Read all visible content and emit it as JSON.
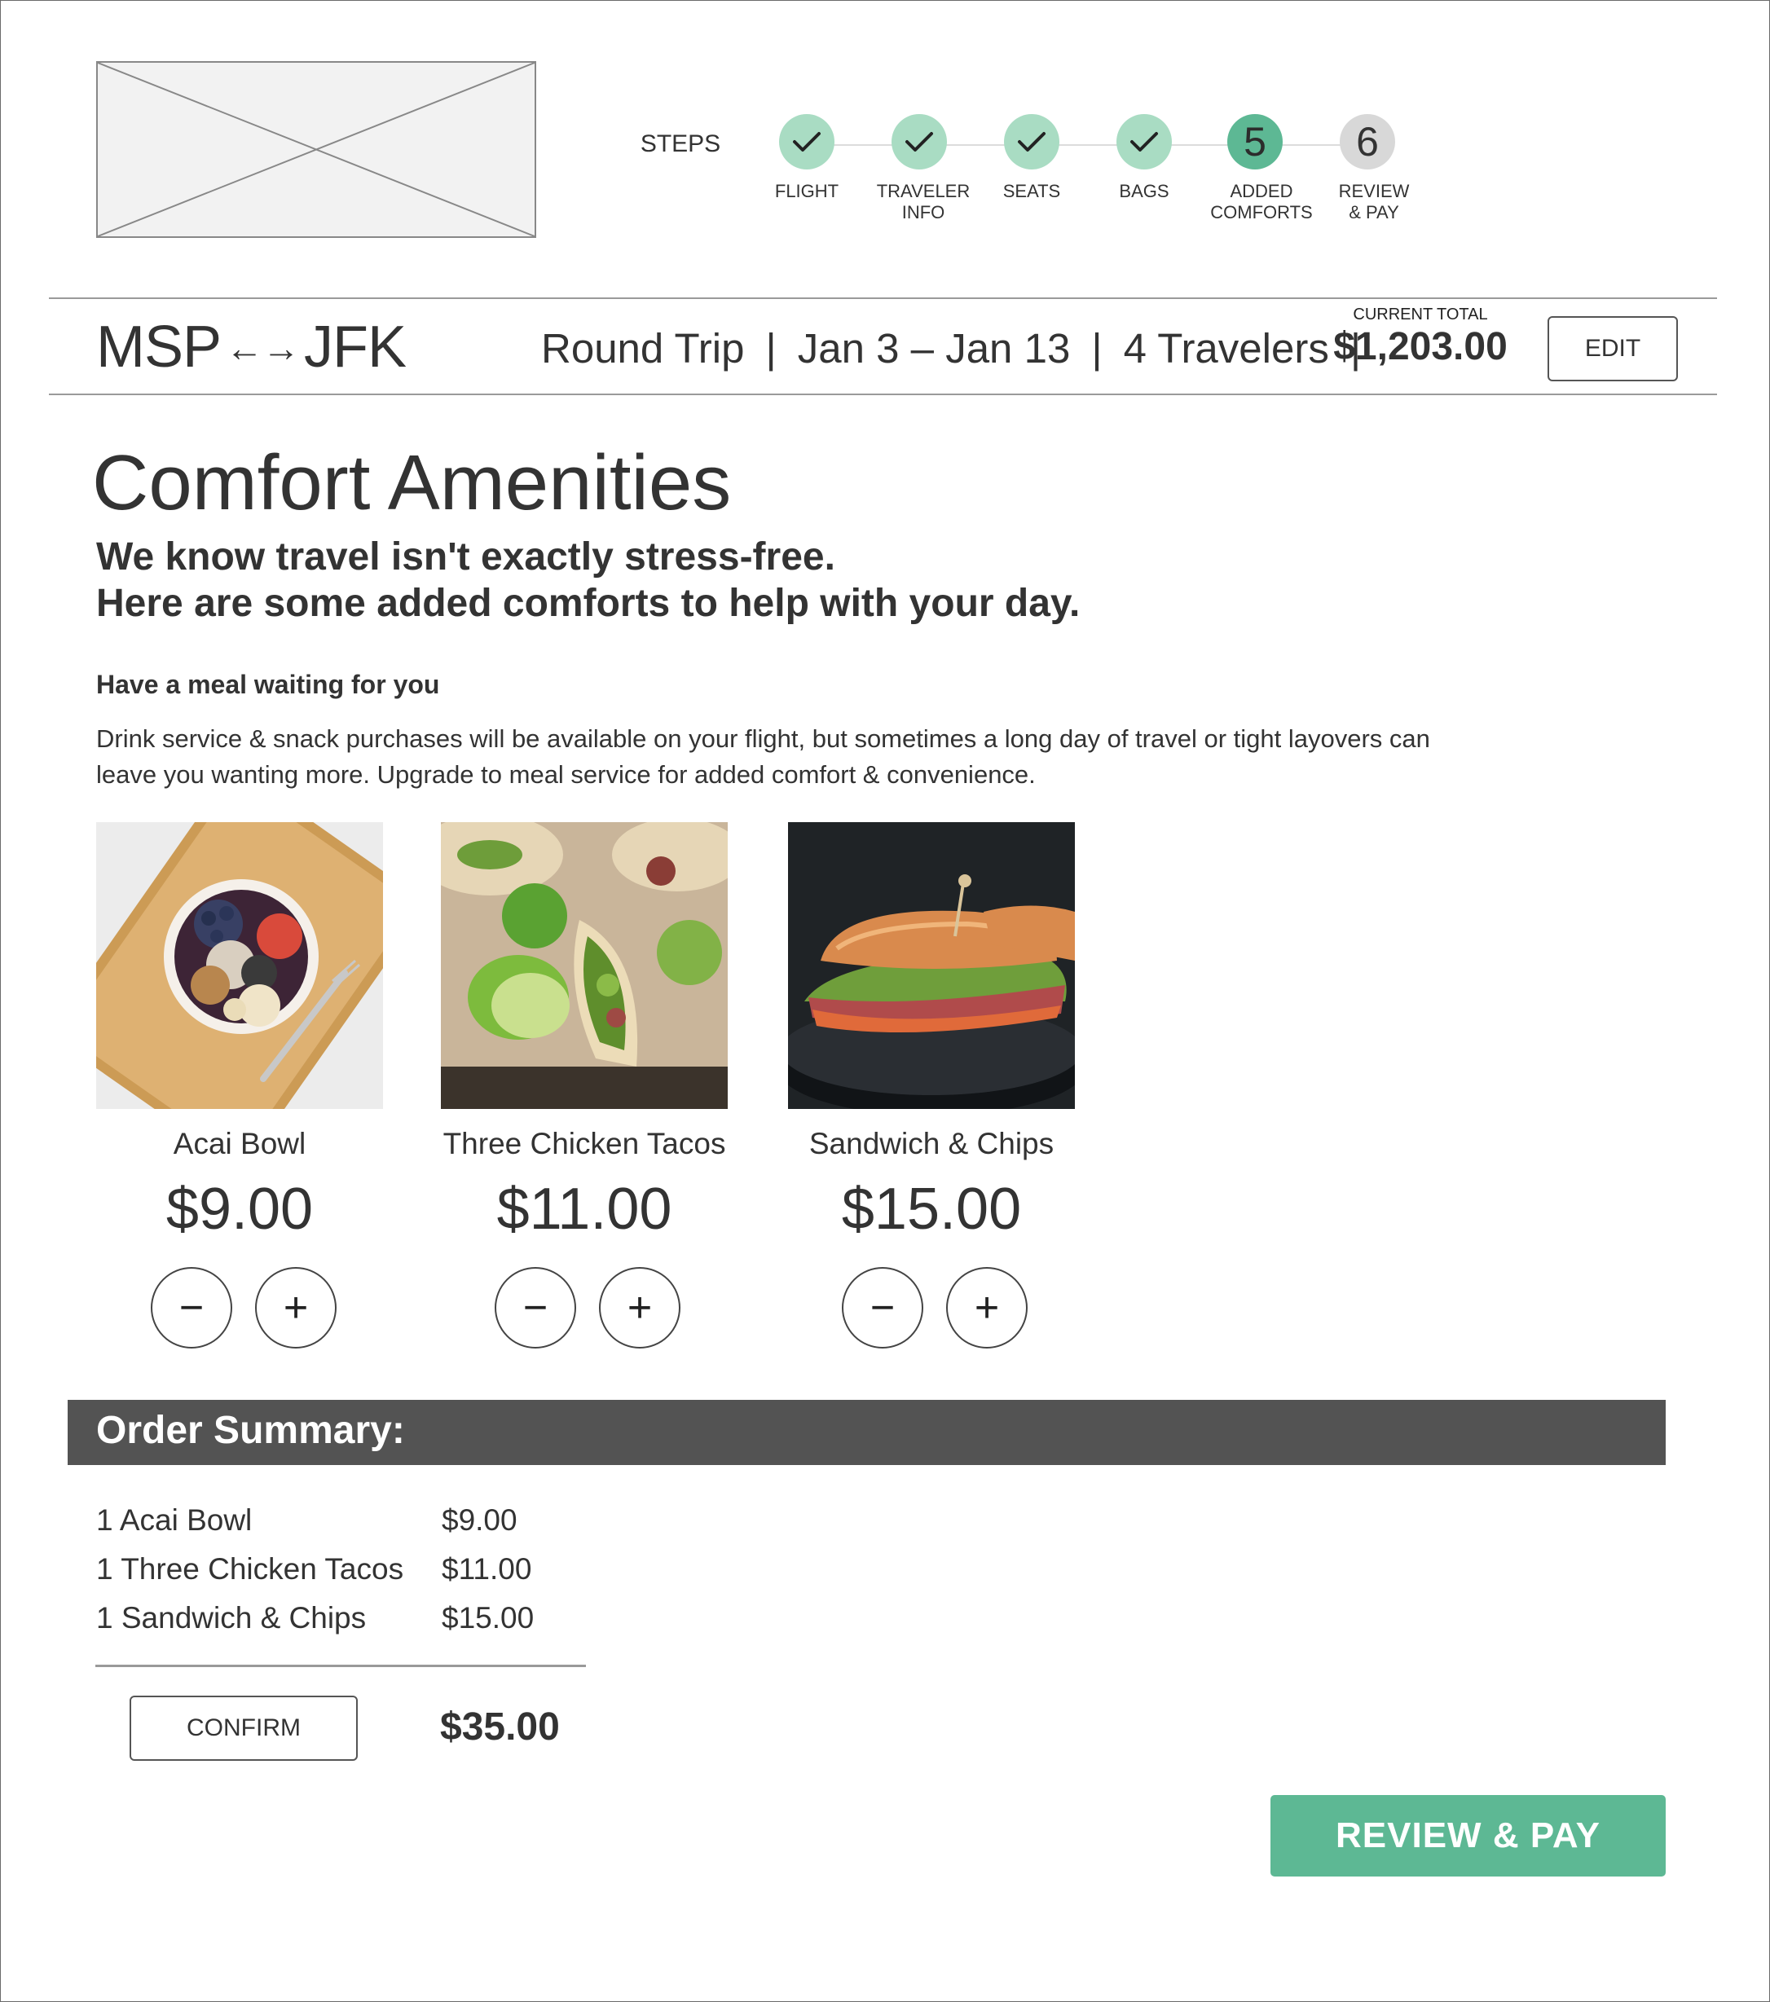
{
  "steps": {
    "label": "STEPS",
    "items": [
      {
        "number": "",
        "label": "FLIGHT",
        "status": "done"
      },
      {
        "number": "",
        "label": "TRAVELER\nINFO",
        "status": "done"
      },
      {
        "number": "",
        "label": "SEATS",
        "status": "done"
      },
      {
        "number": "",
        "label": "BAGS",
        "status": "done"
      },
      {
        "number": "5",
        "label": "ADDED\nCOMFORTS",
        "status": "current"
      },
      {
        "number": "6",
        "label": "REVIEW\n& PAY",
        "status": "upcoming"
      }
    ]
  },
  "trip": {
    "origin": "MSP",
    "arrows": "←→",
    "destination": "JFK",
    "trip_type": "Round Trip",
    "dates": "Jan 3 – Jan 13",
    "travelers": "4 Travelers",
    "separator": "|",
    "total_label": "CURRENT TOTAL",
    "total_value": "$1,203.00",
    "edit_label": "EDIT"
  },
  "page": {
    "title": "Comfort Amenities",
    "intro_line1": "We know travel isn't exactly stress-free.",
    "intro_line2": "Here are some added comforts to help with your day."
  },
  "meal_section": {
    "heading": "Have a meal waiting for you",
    "description": "Drink service & snack purchases will be available on your flight, but sometimes a long day of travel or tight layovers can leave you wanting more. Upgrade to meal service for added comfort & convenience.",
    "items": [
      {
        "name": "Acai Bowl",
        "price": "$9.00",
        "minus": "−",
        "plus": "+"
      },
      {
        "name": "Three Chicken Tacos",
        "price": "$11.00",
        "minus": "−",
        "plus": "+"
      },
      {
        "name": "Sandwich & Chips",
        "price": "$15.00",
        "minus": "−",
        "plus": "+"
      }
    ]
  },
  "order_summary": {
    "title": "Order Summary:",
    "rows": [
      {
        "item": "1 Acai Bowl",
        "price": "$9.00"
      },
      {
        "item": "1 Three Chicken Tacos",
        "price": "$11.00"
      },
      {
        "item": "1 Sandwich & Chips",
        "price": "$15.00"
      }
    ],
    "confirm_label": "CONFIRM",
    "total": "$35.00"
  },
  "review_pay_label": "REVIEW & PAY",
  "colors": {
    "accent": "#5db894",
    "step_done": "#a9dcc3",
    "step_upcoming": "#d8d8d8",
    "summary_bar": "#535353"
  }
}
